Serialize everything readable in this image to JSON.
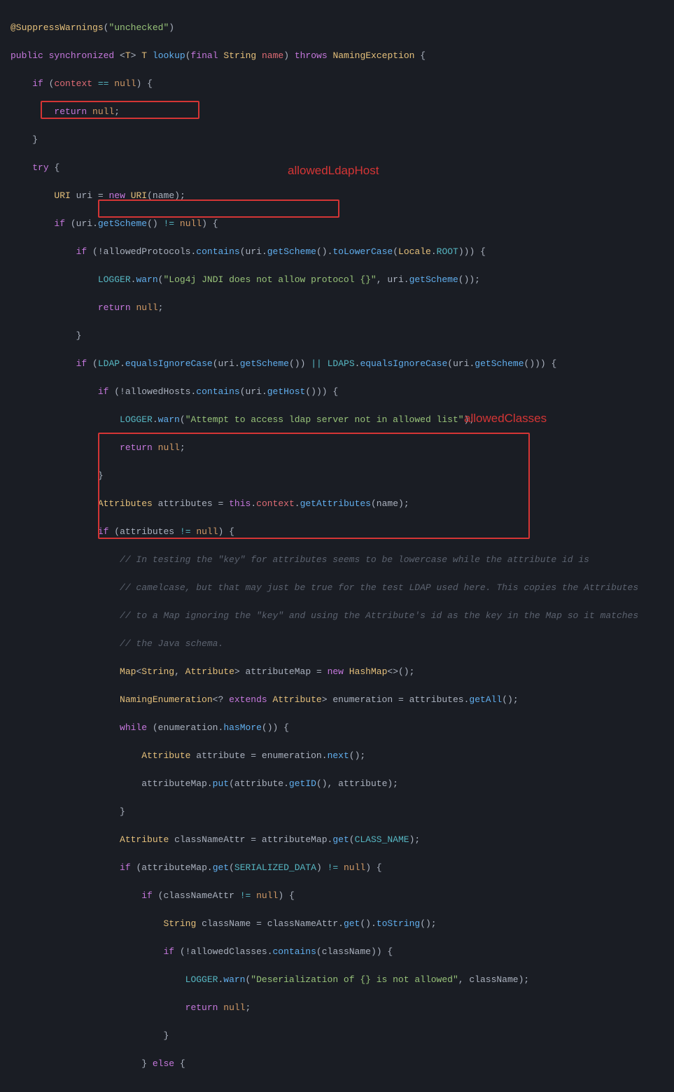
{
  "annotations": {
    "label1": "allowedLdapHost",
    "label2": "allowedClasses"
  },
  "code": {
    "l01_ann": "@SuppressWarnings",
    "l01_str": "\"unchecked\"",
    "l02_kw1": "public synchronized",
    "l02_gen": "<T> T",
    "l02_meth": "lookup",
    "l02_kw2": "final",
    "l02_type": "String",
    "l02_param": "name",
    "l02_kw3": "throws",
    "l02_type2": "NamingException",
    "l03_kw": "if",
    "l03_var": "context",
    "l03_op": "==",
    "l03_null": "null",
    "l04_kw": "return",
    "l04_null": "null",
    "l06_kw": "try",
    "l07_type": "URI",
    "l07_var": "uri",
    "l07_kw": "new",
    "l07_type2": "URI",
    "l07_arg": "name",
    "l08_kw": "if",
    "l08_var": "uri",
    "l08_meth": "getScheme",
    "l08_op": "!=",
    "l08_null": "null",
    "l09_kw": "if",
    "l09_var": "allowedProtocols",
    "l09_meth": "contains",
    "l09_var2": "uri",
    "l09_meth2": "getScheme",
    "l09_meth3": "toLowerCase",
    "l09_const": "Locale",
    "l09_const2": "ROOT",
    "l10_const": "LOGGER",
    "l10_meth": "warn",
    "l10_str": "\"Log4j JNDI does not allow protocol {}\"",
    "l10_var": "uri",
    "l10_meth2": "getScheme",
    "l11_kw": "return",
    "l11_null": "null",
    "l13_kw": "if",
    "l13_const": "LDAP",
    "l13_meth": "equalsIgnoreCase",
    "l13_var": "uri",
    "l13_meth2": "getScheme",
    "l13_op": "||",
    "l13_const2": "LDAPS",
    "l13_meth3": "equalsIgnoreCase",
    "l13_var2": "uri",
    "l13_meth4": "getScheme",
    "l14_kw": "if",
    "l14_var": "allowedHosts",
    "l14_meth": "contains",
    "l14_var2": "uri",
    "l14_meth2": "getHost",
    "l15_const": "LOGGER",
    "l15_meth": "warn",
    "l15_str": "\"Attempt to access ldap server not in allowed list\"",
    "l16_kw": "return",
    "l16_null": "null",
    "l18_type": "Attributes",
    "l18_var": "attributes",
    "l18_this": "this",
    "l18_var2": "context",
    "l18_meth": "getAttributes",
    "l18_arg": "name",
    "l19_kw": "if",
    "l19_var": "attributes",
    "l19_op": "!=",
    "l19_null": "null",
    "l20_c": "// In testing the \"key\" for attributes seems to be lowercase while the attribute id is",
    "l21_c": "// camelcase, but that may just be true for the test LDAP used here. This copies the Attributes",
    "l22_c": "// to a Map ignoring the \"key\" and using the Attribute's id as the key in the Map so it matches",
    "l23_c": "// the Java schema.",
    "l24_type": "Map",
    "l24_type2": "String",
    "l24_type3": "Attribute",
    "l24_var": "attributeMap",
    "l24_kw": "new",
    "l24_type4": "HashMap",
    "l25_type": "NamingEnumeration",
    "l25_kw": "extends",
    "l25_type2": "Attribute",
    "l25_var": "enumeration",
    "l25_var2": "attributes",
    "l25_meth": "getAll",
    "l26_kw": "while",
    "l26_var": "enumeration",
    "l26_meth": "hasMore",
    "l27_type": "Attribute",
    "l27_var": "attribute",
    "l27_var2": "enumeration",
    "l27_meth": "next",
    "l28_var": "attributeMap",
    "l28_meth": "put",
    "l28_var2": "attribute",
    "l28_meth2": "getID",
    "l28_var3": "attribute",
    "l30_type": "Attribute",
    "l30_var": "classNameAttr",
    "l30_var2": "attributeMap",
    "l30_meth": "get",
    "l30_const": "CLASS_NAME",
    "l31_kw": "if",
    "l31_var": "attributeMap",
    "l31_meth": "get",
    "l31_const": "SERIALIZED_DATA",
    "l31_op": "!=",
    "l31_null": "null",
    "l32_kw": "if",
    "l32_var": "classNameAttr",
    "l32_op": "!=",
    "l32_null": "null",
    "l33_type": "String",
    "l33_var": "className",
    "l33_var2": "classNameAttr",
    "l33_meth": "get",
    "l33_meth2": "toString",
    "l34_kw": "if",
    "l34_var": "allowedClasses",
    "l34_meth": "contains",
    "l34_var2": "className",
    "l35_const": "LOGGER",
    "l35_meth": "warn",
    "l35_str": "\"Deserialization of {} is not allowed\"",
    "l35_var": "className",
    "l36_kw": "return",
    "l36_null": "null",
    "l38_kw": "else"
  }
}
